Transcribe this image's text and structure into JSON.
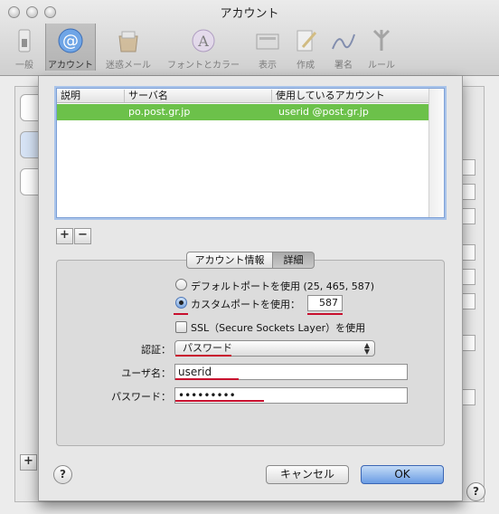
{
  "window": {
    "title": "アカウント"
  },
  "toolbar": [
    {
      "label": "一般",
      "icon": "switch-icon"
    },
    {
      "label": "アカウント",
      "icon": "at-sign-icon",
      "selected": true
    },
    {
      "label": "迷惑メール",
      "icon": "junk-mail-icon"
    },
    {
      "label": "フォントとカラー",
      "icon": "fonts-colors-icon"
    },
    {
      "label": "表示",
      "icon": "viewing-icon"
    },
    {
      "label": "作成",
      "icon": "composing-icon"
    },
    {
      "label": "署名",
      "icon": "signature-icon"
    },
    {
      "label": "ルール",
      "icon": "rules-icon"
    }
  ],
  "server_table": {
    "columns": [
      "説明",
      "サーバ名",
      "使用しているアカウント"
    ],
    "rows": [
      {
        "description": "",
        "server": "po.post.gr.jp",
        "account": "userid @post.gr.jp"
      }
    ],
    "selected_color": "#6cc14a"
  },
  "list_buttons": {
    "add": "+",
    "remove": "−"
  },
  "tabs": [
    {
      "label": "アカウント情報",
      "selected": false
    },
    {
      "label": "詳細",
      "selected": true
    }
  ],
  "advanced": {
    "default_ports_label": "デフォルトポートを使用 (25, 465, 587)",
    "custom_port_label": "カスタムポートを使用：",
    "custom_port_value": "587",
    "port_mode": "custom",
    "ssl_label": "SSL（Secure Sockets Layer）を使用",
    "ssl_checked": false,
    "auth_label": "認証：",
    "auth_value": "パスワード",
    "username_label": "ユーザ名：",
    "username_value": "userid",
    "password_label": "パスワード：",
    "password_value": "•••••••••"
  },
  "buttons": {
    "cancel": "キャンセル",
    "ok": "OK",
    "help": "?"
  },
  "annotation_color": "#c8102e",
  "background_window": {
    "add_button": "+",
    "help": "?"
  }
}
